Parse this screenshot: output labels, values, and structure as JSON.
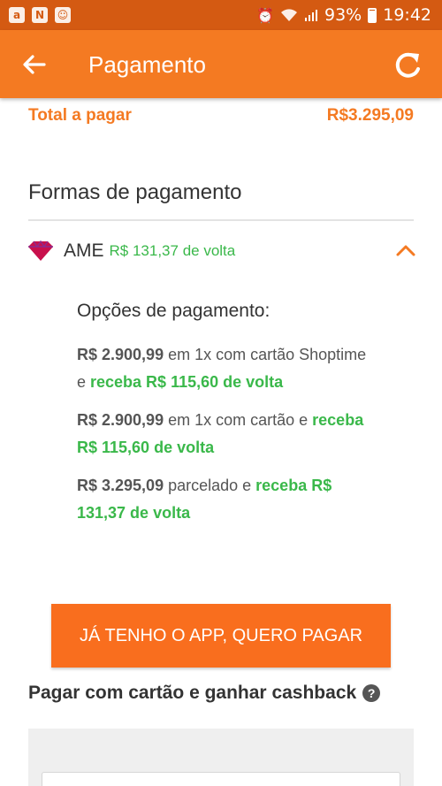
{
  "status_bar": {
    "battery": "93%",
    "time": "19:42",
    "left_icons": [
      "a",
      "N",
      "☺"
    ]
  },
  "header": {
    "title": "Pagamento"
  },
  "total": {
    "label": "Total a pagar",
    "value": "R$3.295,09"
  },
  "payment_methods": {
    "title": "Formas de pagamento",
    "ame": {
      "name": "AME",
      "cashback": "R$ 131,37 de volta",
      "options_title": "Opções de pagamento:",
      "options": [
        {
          "amount": "R$ 2.900,99",
          "text": " em 1x com cartão Shoptime e ",
          "highlight": "receba R$ 115,60 de volta"
        },
        {
          "amount": "R$ 2.900,99",
          "text": " em 1x com cartão e ",
          "highlight": "receba R$ 115,60 de volta"
        },
        {
          "amount": "R$ 3.295,09",
          "text": " parcelado e ",
          "highlight": "receba R$ 131,37 de volta"
        }
      ],
      "button_label": "JÁ TENHO O APP, QUERO PAGAR"
    }
  },
  "card_section": {
    "title": "Pagar com cartão e ganhar cashback",
    "help": "?"
  },
  "colors": {
    "status_bar": "#d45a12",
    "app_bar": "#f47a22",
    "accent_orange": "#f47a22",
    "button": "#f96e1e",
    "cashback_green": "#3ab84a",
    "ame_logo": "#c8104c"
  },
  "icons": {
    "back": "arrow-left-icon",
    "refresh": "refresh-icon",
    "ame_logo": "ame-diamond-logo",
    "expand": "chevron-up-icon",
    "help": "question-circle-icon"
  }
}
